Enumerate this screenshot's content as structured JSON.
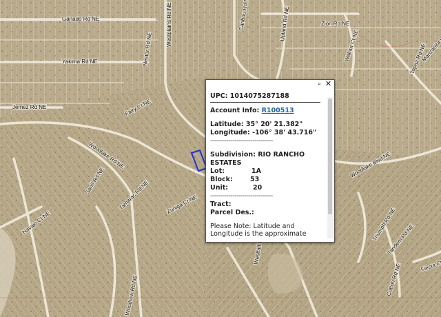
{
  "map": {
    "roads": [
      "Ganado Rd NE",
      "Yakima Rd NE",
      "Jemez Rd NE",
      "Zion Rd NE",
      "Walnut Ct NE",
      "Fairy Ct NE",
      "Woodlake Rd NE",
      "Nestor Rd NE",
      "Tamarac Rd NE",
      "Sanil Rd NE",
      "Navajo Ct NE",
      "Westplains Rd NE",
      "Caribou Rd NE",
      "Upland Rd NE",
      "Westfall Blvd NE",
      "Zuniga Ct NE",
      "Triumph Rd NE",
      "Tandem Rd NE",
      "Cotton Rd NE",
      "Fiesta Ct NE",
      "Woodrow Rd NE",
      "Woodlake Blvd NE",
      "Topaz Rd NE",
      "Manzanita Rd NE"
    ]
  },
  "popup": {
    "upc_label": "UPC:",
    "upc_value": "1014075287188",
    "account_label": "Account Info:",
    "account_value": "R100513",
    "latitude_label": "Latitude:",
    "latitude_value": "35° 20' 21.382\"",
    "longitude_label": "Longitude:",
    "longitude_value": "-106° 38' 43.716\"",
    "divider": "-------------------------------",
    "subdivision_label": "Subdivision:",
    "subdivision_value": "RIO RANCHO ESTATES",
    "lot_label": "Lot:",
    "lot_value": "1A",
    "block_label": "Block:",
    "block_value": "53",
    "unit_label": "Unit:",
    "unit_value": "20",
    "tract_label": "Tract:",
    "parcel_label": "Parcel Des.:",
    "note": "Please Note: Latitude and Longitude is the approximate center of the parcel shown."
  }
}
